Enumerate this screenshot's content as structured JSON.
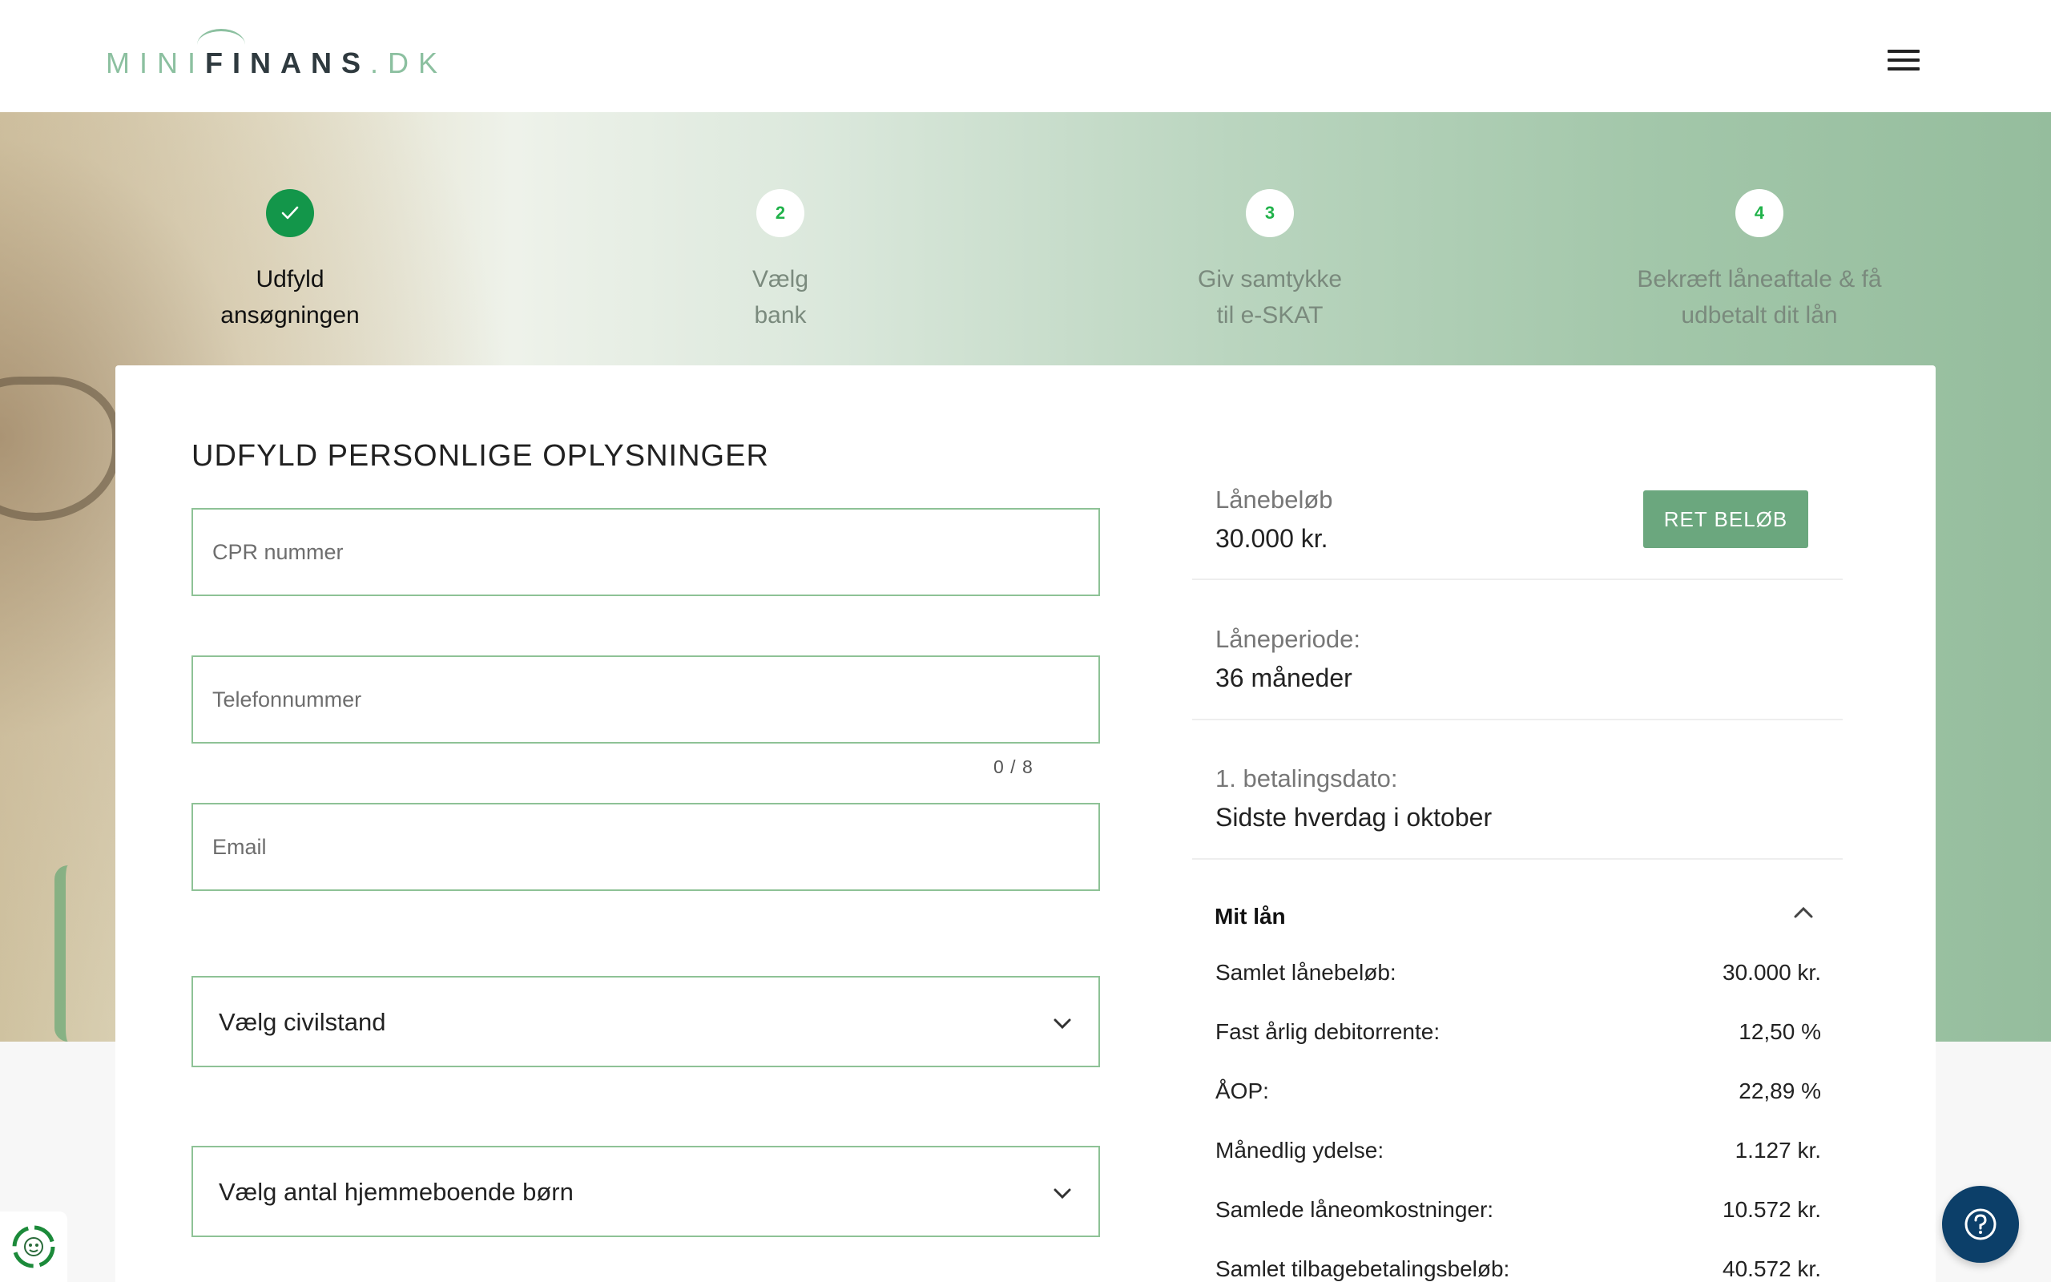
{
  "brand": {
    "mini": "MINI",
    "finans": "FINANS",
    "dk": ".DK",
    "accent": "#8cc0a0",
    "dark": "#2f3a3f"
  },
  "header": {
    "menu_icon": "hamburger-menu-icon"
  },
  "steps": [
    {
      "number": "",
      "line1": "Udfyld",
      "line2": "ansøgningen",
      "state": "done"
    },
    {
      "number": "2",
      "line1": "Vælg",
      "line2": "bank",
      "state": "pending"
    },
    {
      "number": "3",
      "line1": "Giv samtykke",
      "line2": "til e-SKAT",
      "state": "pending"
    },
    {
      "number": "4",
      "line1": "Bekræft låneaftale & få",
      "line2": "udbetalt dit lån",
      "state": "pending"
    }
  ],
  "form": {
    "title": "UDFYLD PERSONLIGE OPLYSNINGER",
    "cpr_placeholder": "CPR nummer",
    "phone_placeholder": "Telefonnummer",
    "phone_counter": "0 / 8",
    "email_placeholder": "Email",
    "civilstand_label": "Vælg civilstand",
    "children_label": "Vælg antal hjemmeboende børn"
  },
  "summary": {
    "amount_label": "Lånebeløb",
    "amount_value": "30.000 kr.",
    "edit_button": "RET BELØB",
    "period_label": "Låneperiode:",
    "period_value": "36 måneder",
    "first_payment_label": "1. betalingsdato:",
    "first_payment_value": "Sidste hverdag i oktober",
    "my_loan_title": "Mit lån",
    "rows": [
      {
        "label": "Samlet lånebeløb:",
        "value": "30.000 kr."
      },
      {
        "label": "Fast årlig debitorrente:",
        "value": "12,50 %"
      },
      {
        "label": "ÅOP:",
        "value": "22,89 %"
      },
      {
        "label": "Månedlig ydelse:",
        "value": "1.127 kr."
      },
      {
        "label": "Samlede låneomkostninger:",
        "value": "10.572 kr."
      },
      {
        "label": "Samlet tilbagebetalingsbeløb:",
        "value": "40.572 kr."
      }
    ]
  },
  "colors": {
    "step_done": "#13964a",
    "step_number": "#20b24a",
    "button": "#6ba77e",
    "help": "#0c3f69",
    "field_border": "#8ec296"
  }
}
